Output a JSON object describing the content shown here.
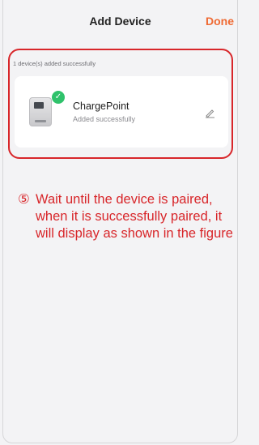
{
  "header": {
    "title": "Add Device",
    "done_label": "Done"
  },
  "list": {
    "summary": "1 device(s) added successfully",
    "devices": [
      {
        "name": "ChargePoint",
        "status": "Added successfully"
      }
    ]
  },
  "instruction": {
    "marker": "⑤",
    "text": "Wait until the device is paired, when it is successfully paired, it will display as shown in the figure"
  },
  "colors": {
    "accent": "#ef6a33",
    "annotation": "#d8262a",
    "success": "#2fc26b"
  },
  "icons": [
    "check-icon",
    "edit-icon"
  ]
}
